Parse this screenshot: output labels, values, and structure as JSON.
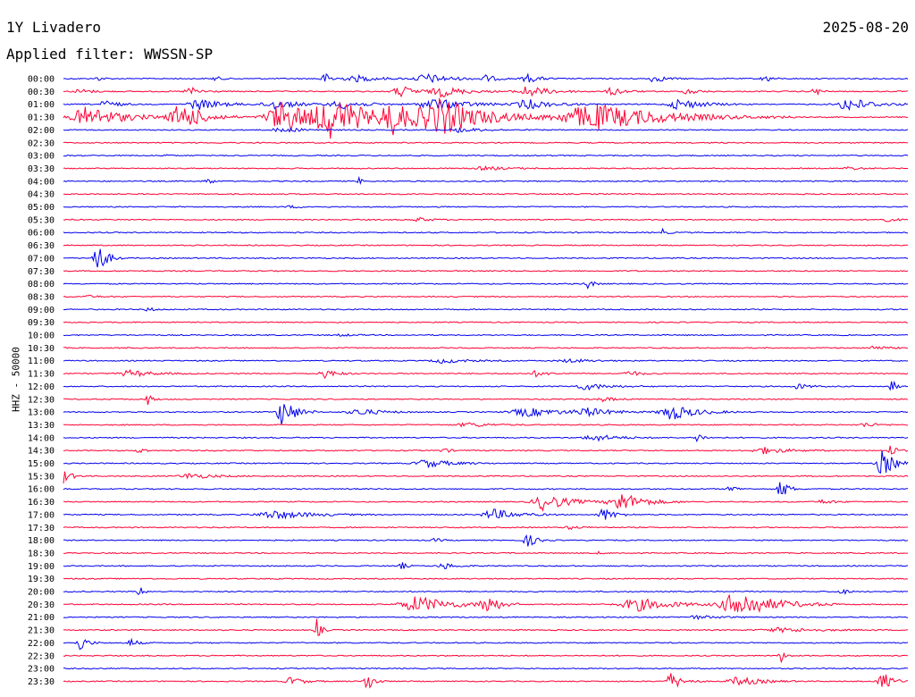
{
  "header": {
    "station": "1Y Livadero",
    "date": "2025-08-20",
    "filter_label": "Applied filter: WWSSN-SP"
  },
  "colors": {
    "trace_a": "#0000ee",
    "trace_b": "#ff0033",
    "background": "#ffffff"
  },
  "chart_data": {
    "type": "line",
    "title": "1Y Livadero",
    "subtitle": "Applied filter: WWSSN-SP",
    "ylabel": "HHZ - 50000",
    "legend": "none",
    "grid": false,
    "time_labels": [
      "00:00",
      "00:30",
      "01:00",
      "01:30",
      "02:00",
      "02:30",
      "03:00",
      "03:30",
      "04:00",
      "04:30",
      "05:00",
      "05:30",
      "06:00",
      "06:30",
      "07:00",
      "07:30",
      "08:00",
      "08:30",
      "09:00",
      "09:30",
      "10:00",
      "10:30",
      "11:00",
      "11:30",
      "12:00",
      "12:30",
      "13:00",
      "13:30",
      "14:00",
      "14:30",
      "15:00",
      "15:30",
      "16:00",
      "16:30",
      "17:00",
      "17:30",
      "18:00",
      "18:30",
      "19:00",
      "19:30",
      "20:00",
      "20:30",
      "21:00",
      "21:30",
      "22:00",
      "22:30",
      "23:00",
      "23:30"
    ],
    "series": [
      {
        "time": "00:00",
        "events": [
          [
            0.04,
            0.4,
            0.005
          ],
          [
            0.18,
            0.5,
            0.005
          ],
          [
            0.31,
            0.9,
            0.01
          ],
          [
            0.35,
            0.5,
            0.02
          ],
          [
            0.43,
            0.9,
            0.02
          ],
          [
            0.5,
            0.6,
            0.01
          ],
          [
            0.55,
            0.8,
            0.01
          ],
          [
            0.7,
            0.7,
            0.01
          ],
          [
            0.83,
            1.0,
            0.005
          ]
        ]
      },
      {
        "time": "00:30",
        "events": [
          [
            0.02,
            0.5,
            0.01
          ],
          [
            0.15,
            0.8,
            0.01
          ],
          [
            0.4,
            1.0,
            0.015
          ],
          [
            0.45,
            0.9,
            0.02
          ],
          [
            0.55,
            1.0,
            0.02
          ],
          [
            0.65,
            0.8,
            0.01
          ],
          [
            0.74,
            0.7,
            0.008
          ],
          [
            0.89,
            0.9,
            0.005
          ]
        ]
      },
      {
        "time": "01:00",
        "events": [
          [
            0.05,
            0.8,
            0.01
          ],
          [
            0.16,
            1.0,
            0.02
          ],
          [
            0.25,
            0.9,
            0.02
          ],
          [
            0.33,
            0.8,
            0.02
          ],
          [
            0.44,
            1.0,
            0.03
          ],
          [
            0.55,
            0.9,
            0.02
          ],
          [
            0.73,
            1.0,
            0.02
          ],
          [
            0.93,
            1.3,
            0.02
          ]
        ]
      },
      {
        "time": "01:30",
        "events": [
          [
            0.03,
            2.0,
            0.03
          ],
          [
            0.14,
            2.5,
            0.02
          ],
          [
            0.26,
            3.0,
            0.03
          ],
          [
            0.32,
            3.5,
            0.03
          ],
          [
            0.39,
            2.8,
            0.02
          ],
          [
            0.45,
            3.2,
            0.04
          ],
          [
            0.63,
            2.5,
            0.06
          ]
        ]
      },
      {
        "time": "02:00",
        "events": [
          [
            0.26,
            0.4,
            0.02
          ],
          [
            0.47,
            0.4,
            0.02
          ]
        ]
      },
      {
        "time": "02:30",
        "events": []
      },
      {
        "time": "03:00",
        "events": [
          [
            0.12,
            0.5,
            0.003
          ]
        ]
      },
      {
        "time": "03:30",
        "events": [
          [
            0.5,
            0.3,
            0.02
          ],
          [
            0.93,
            0.3,
            0.01
          ]
        ]
      },
      {
        "time": "04:00",
        "events": [
          [
            0.17,
            0.7,
            0.005
          ],
          [
            0.35,
            0.6,
            0.003
          ]
        ]
      },
      {
        "time": "04:30",
        "events": []
      },
      {
        "time": "05:00",
        "events": [
          [
            0.27,
            0.2,
            0.01
          ]
        ]
      },
      {
        "time": "05:30",
        "events": [
          [
            0.42,
            0.4,
            0.01
          ],
          [
            0.97,
            0.4,
            0.01
          ]
        ]
      },
      {
        "time": "06:00",
        "events": [
          [
            0.71,
            0.6,
            0.004
          ]
        ]
      },
      {
        "time": "06:30",
        "events": []
      },
      {
        "time": "07:00",
        "events": [
          [
            0.04,
            3.0,
            0.008
          ]
        ]
      },
      {
        "time": "07:30",
        "events": []
      },
      {
        "time": "08:00",
        "events": [
          [
            0.62,
            1.0,
            0.005
          ]
        ]
      },
      {
        "time": "08:30",
        "events": [
          [
            0.03,
            0.2,
            0.01
          ]
        ]
      },
      {
        "time": "09:00",
        "events": [
          [
            0.1,
            0.4,
            0.005
          ]
        ]
      },
      {
        "time": "09:30",
        "events": []
      },
      {
        "time": "10:00",
        "events": [
          [
            0.33,
            0.2,
            0.01
          ]
        ]
      },
      {
        "time": "10:30",
        "events": [
          [
            0.96,
            0.4,
            0.01
          ]
        ]
      },
      {
        "time": "11:00",
        "events": [
          [
            0.45,
            0.4,
            0.02
          ],
          [
            0.6,
            0.3,
            0.02
          ]
        ]
      },
      {
        "time": "11:30",
        "events": [
          [
            0.08,
            0.6,
            0.02
          ],
          [
            0.31,
            0.8,
            0.01
          ],
          [
            0.56,
            0.5,
            0.01
          ],
          [
            0.67,
            0.5,
            0.01
          ]
        ]
      },
      {
        "time": "12:00",
        "events": [
          [
            0.62,
            0.6,
            0.02
          ],
          [
            0.87,
            0.5,
            0.01
          ],
          [
            0.98,
            1.5,
            0.004
          ]
        ]
      },
      {
        "time": "12:30",
        "events": [
          [
            0.1,
            1.0,
            0.004
          ],
          [
            0.64,
            0.4,
            0.01
          ]
        ]
      },
      {
        "time": "13:00",
        "events": [
          [
            0.26,
            3.0,
            0.01
          ],
          [
            0.35,
            0.6,
            0.02
          ],
          [
            0.55,
            0.8,
            0.03
          ],
          [
            0.62,
            0.7,
            0.02
          ],
          [
            0.72,
            1.5,
            0.02
          ]
        ]
      },
      {
        "time": "13:30",
        "events": [
          [
            0.48,
            0.4,
            0.02
          ],
          [
            0.95,
            0.4,
            0.01
          ]
        ]
      },
      {
        "time": "14:00",
        "events": [
          [
            0.63,
            0.6,
            0.02
          ],
          [
            0.75,
            1.0,
            0.005
          ]
        ]
      },
      {
        "time": "14:30",
        "events": [
          [
            0.09,
            1.0,
            0.004
          ],
          [
            0.45,
            0.8,
            0.004
          ],
          [
            0.83,
            0.6,
            0.02
          ],
          [
            0.98,
            1.2,
            0.005
          ]
        ]
      },
      {
        "time": "15:00",
        "events": [
          [
            0.43,
            0.8,
            0.02
          ],
          [
            0.97,
            2.5,
            0.01
          ]
        ]
      },
      {
        "time": "15:30",
        "events": [
          [
            0.0,
            1.5,
            0.006
          ],
          [
            0.15,
            0.5,
            0.02
          ]
        ]
      },
      {
        "time": "16:00",
        "events": [
          [
            0.79,
            0.8,
            0.005
          ],
          [
            0.85,
            2.0,
            0.006
          ]
        ]
      },
      {
        "time": "16:30",
        "events": [
          [
            0.57,
            1.6,
            0.02
          ],
          [
            0.66,
            1.8,
            0.02
          ],
          [
            0.9,
            0.4,
            0.01
          ]
        ]
      },
      {
        "time": "17:00",
        "events": [
          [
            0.25,
            0.8,
            0.03
          ],
          [
            0.51,
            1.0,
            0.02
          ],
          [
            0.64,
            1.2,
            0.01
          ]
        ]
      },
      {
        "time": "17:30",
        "events": [
          [
            0.6,
            0.3,
            0.01
          ]
        ]
      },
      {
        "time": "18:00",
        "events": [
          [
            0.44,
            0.4,
            0.005
          ],
          [
            0.55,
            1.2,
            0.008
          ]
        ]
      },
      {
        "time": "18:30",
        "events": [
          [
            0.63,
            0.4,
            0.004
          ]
        ]
      },
      {
        "time": "19:00",
        "events": [
          [
            0.4,
            0.8,
            0.004
          ],
          [
            0.45,
            0.6,
            0.01
          ]
        ]
      },
      {
        "time": "19:30",
        "events": []
      },
      {
        "time": "20:00",
        "events": [
          [
            0.09,
            1.0,
            0.004
          ],
          [
            0.92,
            0.8,
            0.005
          ]
        ]
      },
      {
        "time": "20:30",
        "events": [
          [
            0.42,
            1.5,
            0.03
          ],
          [
            0.5,
            2.0,
            0.01
          ],
          [
            0.68,
            1.2,
            0.03
          ],
          [
            0.8,
            2.5,
            0.03
          ]
        ]
      },
      {
        "time": "21:00",
        "events": [
          [
            0.75,
            0.3,
            0.02
          ]
        ]
      },
      {
        "time": "21:30",
        "events": [
          [
            0.3,
            2.0,
            0.004
          ],
          [
            0.85,
            0.4,
            0.03
          ]
        ]
      },
      {
        "time": "22:00",
        "events": [
          [
            0.02,
            1.5,
            0.006
          ],
          [
            0.08,
            0.8,
            0.006
          ]
        ]
      },
      {
        "time": "22:30",
        "events": [
          [
            0.85,
            1.2,
            0.004
          ]
        ]
      },
      {
        "time": "23:00",
        "events": []
      },
      {
        "time": "23:30",
        "events": [
          [
            0.27,
            0.8,
            0.01
          ],
          [
            0.36,
            2.0,
            0.006
          ],
          [
            0.72,
            1.5,
            0.01
          ],
          [
            0.8,
            0.8,
            0.02
          ],
          [
            0.97,
            1.8,
            0.008
          ]
        ]
      }
    ]
  }
}
